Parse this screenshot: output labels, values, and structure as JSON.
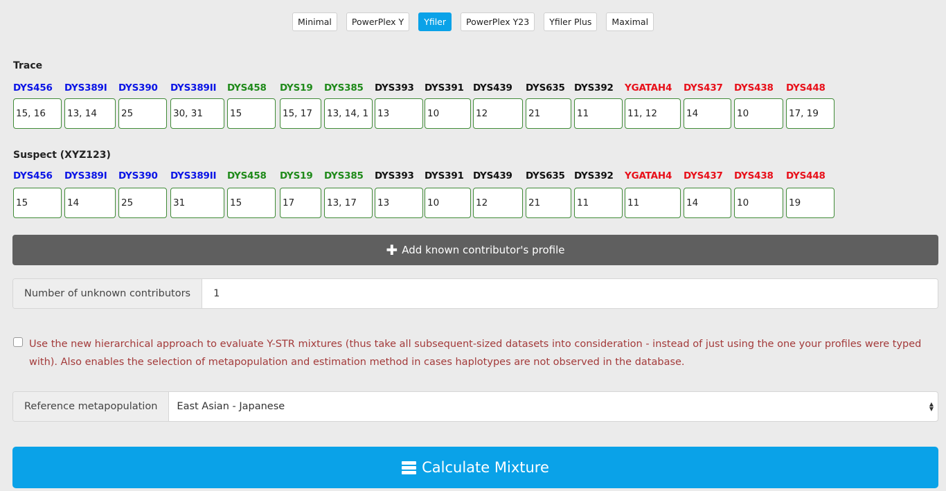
{
  "kits": [
    {
      "label": "Minimal",
      "active": false
    },
    {
      "label": "PowerPlex Y",
      "active": false
    },
    {
      "label": "Yfiler",
      "active": true
    },
    {
      "label": "PowerPlex Y23",
      "active": false
    },
    {
      "label": "Yfiler Plus",
      "active": false
    },
    {
      "label": "Maximal",
      "active": false
    }
  ],
  "colors": {
    "blue": "#0a14e6",
    "green": "#1f8a1a",
    "black": "#111111",
    "red": "#e8101a",
    "accent": "#0aa2e8",
    "dark_bar": "#5f5f5f",
    "warning_text": "#a33a3a"
  },
  "markers": [
    {
      "name": "DYS456",
      "color": "blue"
    },
    {
      "name": "DYS389I",
      "color": "blue"
    },
    {
      "name": "DYS390",
      "color": "blue"
    },
    {
      "name": "DYS389II",
      "color": "blue"
    },
    {
      "name": "DYS458",
      "color": "green"
    },
    {
      "name": "DYS19",
      "color": "green"
    },
    {
      "name": "DYS385",
      "color": "green"
    },
    {
      "name": "DYS393",
      "color": "black"
    },
    {
      "name": "DYS391",
      "color": "black"
    },
    {
      "name": "DYS439",
      "color": "black"
    },
    {
      "name": "DYS635",
      "color": "black"
    },
    {
      "name": "DYS392",
      "color": "black"
    },
    {
      "name": "YGATAH4",
      "color": "red"
    },
    {
      "name": "DYS437",
      "color": "red"
    },
    {
      "name": "DYS438",
      "color": "red"
    },
    {
      "name": "DYS448",
      "color": "red"
    }
  ],
  "trace": {
    "title": "Trace",
    "alleles": [
      "15, 16",
      "13, 14",
      "25",
      "30, 31",
      "15",
      "15, 17",
      "13, 14, 1",
      "13",
      "10",
      "12",
      "21",
      "11",
      "11, 12",
      "14",
      "10",
      "17, 19"
    ]
  },
  "suspect": {
    "title": "Suspect (XYZ123)",
    "alleles": [
      "15",
      "14",
      "25",
      "31",
      "15",
      "17",
      "13, 17",
      "13",
      "10",
      "12",
      "21",
      "11",
      "11",
      "14",
      "10",
      "19"
    ]
  },
  "add_contributor": {
    "icon": "plus-icon",
    "label": "Add known contributor's profile"
  },
  "unknown_contributors": {
    "label": "Number of unknown contributors",
    "value": "1"
  },
  "hierarchical": {
    "checked": false,
    "text": "Use the new hierarchical approach to evaluate Y-STR mixtures (thus take all subsequent-sized datasets into consideration - instead of just using the one your profiles were typed with). Also enables the selection of metapopulation and estimation method in cases haplotypes are not observed in the database."
  },
  "metapopulation": {
    "label": "Reference metapopulation",
    "selected": "East Asian - Japanese"
  },
  "calculate": {
    "icon": "server-icon",
    "label": "Calculate Mixture"
  }
}
